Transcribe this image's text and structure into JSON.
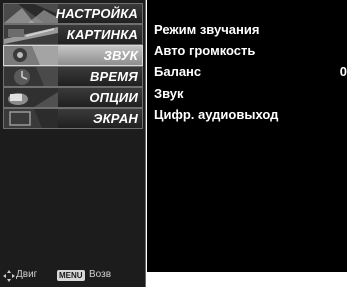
{
  "menu": {
    "items": [
      {
        "label": "НАСТРОЙКА",
        "icon": "setup-thumbnail-icon"
      },
      {
        "label": "КАРТИНКА",
        "icon": "picture-thumbnail-icon"
      },
      {
        "label": "ЗВУК",
        "icon": "sound-thumbnail-icon",
        "selected": true
      },
      {
        "label": "ВРЕМЯ",
        "icon": "time-thumbnail-icon"
      },
      {
        "label": "ОПЦИИ",
        "icon": "option-thumbnail-icon"
      },
      {
        "label": "ЭКРАН",
        "icon": "screen-thumbnail-icon"
      }
    ]
  },
  "submenu": {
    "items": [
      {
        "label": "Режим звучания"
      },
      {
        "label": "Авто громкость"
      },
      {
        "label": "Баланс",
        "value": "0"
      },
      {
        "label": "Звук"
      },
      {
        "label": "Цифр. аудиовыход"
      }
    ]
  },
  "footer": {
    "move_label": "Двиг",
    "menu_key": "MENU",
    "back_label": "Возв"
  },
  "colors": {
    "panel_bg": "#000000",
    "menu_bg": "#1c1c1c",
    "selected_bg": "#a8a8a8",
    "text": "#ffffff"
  }
}
